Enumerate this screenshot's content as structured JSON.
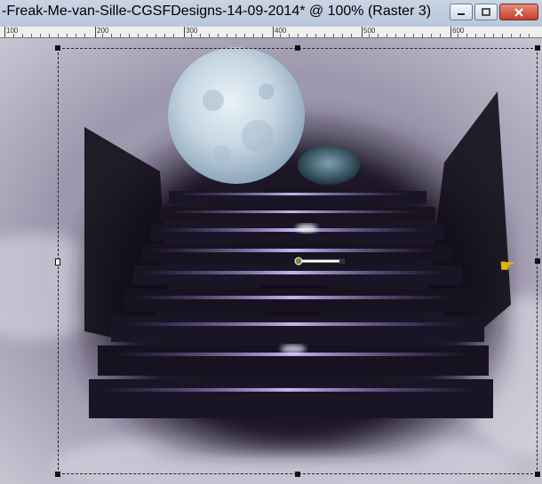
{
  "window": {
    "title": "-Freak-Me-van-Sille-CGSFDesigns-14-09-2014* @ 100% (Raster 3)",
    "minimize_icon": "minimize-icon",
    "maximize_icon": "maximize-icon",
    "close_icon": "close-icon"
  },
  "ruler": {
    "labels": [
      "100",
      "200",
      "300",
      "400",
      "500",
      "600"
    ]
  },
  "canvas": {
    "zoom": "100%",
    "layer": "Raster 3"
  },
  "icons": {
    "pointer": "pointing-hand-icon"
  }
}
